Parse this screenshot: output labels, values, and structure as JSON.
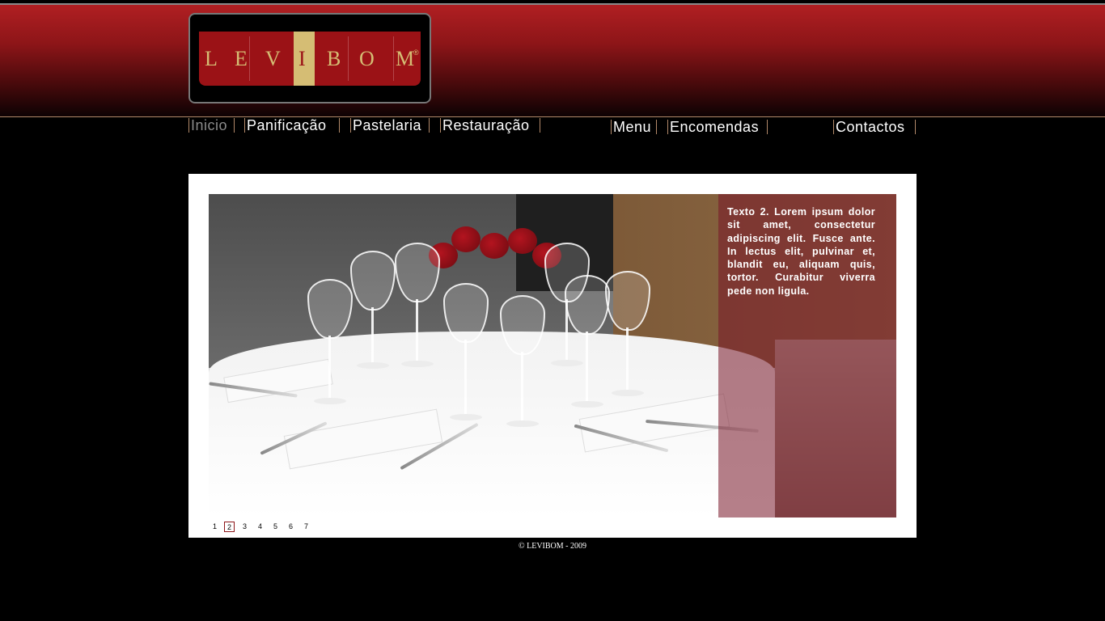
{
  "brand": {
    "letters": [
      "L",
      "E",
      "V",
      "I",
      "B",
      "O",
      "M"
    ],
    "registered_mark": "®"
  },
  "nav": {
    "items": [
      {
        "label": "Inicio",
        "active": true
      },
      {
        "label": "Panificação",
        "active": false
      },
      {
        "label": "Pastelaria",
        "active": false
      },
      {
        "label": "Restauração",
        "active": false
      },
      {
        "label": "Menu",
        "active": false
      },
      {
        "label": "Encomendas",
        "active": false
      },
      {
        "label": "Contactos",
        "active": false
      }
    ]
  },
  "slideshow": {
    "caption": "Texto 2. Lorem ipsum dolor sit amet, consectetur adipiscing elit. Fusce ante. In lectus elit, pulvinar et, blandit eu, aliquam quis, tortor. Curabitur viverra pede non ligula.",
    "pages": [
      "1",
      "2",
      "3",
      "4",
      "5",
      "6",
      "7"
    ],
    "current_page": "2"
  },
  "footer": {
    "text": "© LEVIBOM - 2009"
  },
  "colors": {
    "header_red": "#b01f22",
    "logo_red": "#9b1216",
    "logo_gold": "#d5bd74",
    "overlay": "#781628"
  }
}
